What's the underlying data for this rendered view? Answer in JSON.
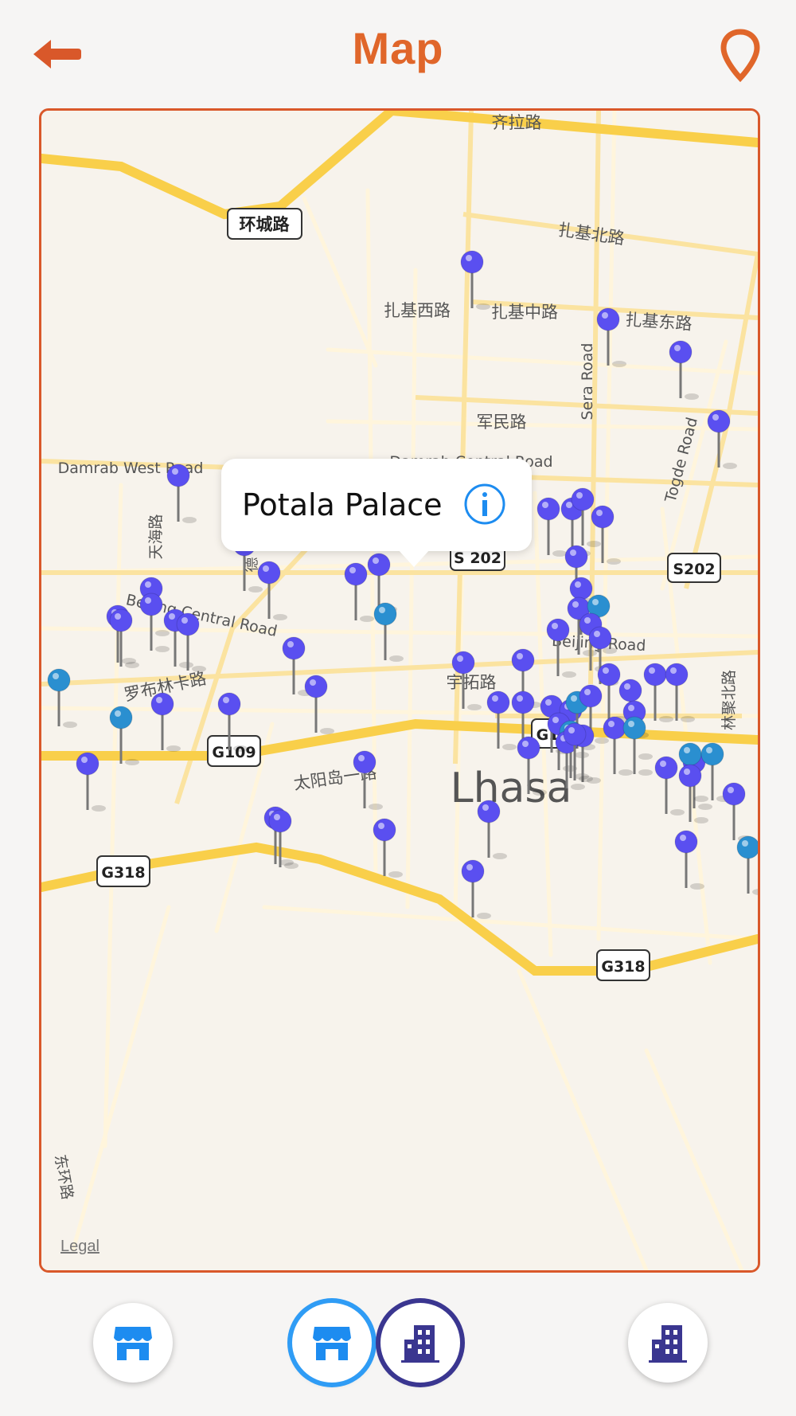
{
  "header": {
    "title": "Map",
    "back_icon": "arrow-left-icon",
    "location_icon": "map-pin-icon",
    "accent_color": "#e0662a"
  },
  "map": {
    "labels": {
      "qila_road": "齐拉路",
      "huancheng_road": "环城路",
      "zhaji_north": "扎基北路",
      "zhaji_west": "扎基西路",
      "zhaji_middle": "扎基中路",
      "zhaji_east": "扎基东路",
      "junmin_road": "军民路",
      "sera_road": "Sera Road",
      "togde_road": "Togde Road",
      "damrab_west": "Damrab West Road",
      "damrab_central": "Damrab Central Road",
      "tianhai_road": "天海路",
      "de_road": "德",
      "beijing_central": "Beijing Central Road",
      "beijing_road": "Beijing Road",
      "luobulinka_road": "罗布林卡路",
      "yutuo_road": "宇拓路",
      "linju_north": "林聚北路",
      "taiyangdao_road": "太阳岛一路",
      "city_name": "Lhasa",
      "dunhuan_road": "东环路"
    },
    "shields": [
      "环城路",
      "S 202",
      "S202",
      "G109",
      "G318",
      "G318",
      "G1"
    ],
    "legal": "Legal",
    "pin_colors": {
      "purple": "#5a4ff0",
      "teal": "#2a8fd0"
    },
    "callout": {
      "title": "Potala Palace",
      "info_icon": "info-circle-icon"
    }
  },
  "bottom_bar": {
    "buttons": [
      {
        "name": "shop-filter-button",
        "icon": "store-icon"
      },
      {
        "name": "shop-active-button",
        "icon": "store-icon"
      },
      {
        "name": "building-active-button",
        "icon": "building-icon"
      },
      {
        "name": "building-filter-button",
        "icon": "building-icon"
      }
    ],
    "ring_colors": {
      "blue": "#2f9cf5",
      "indigo": "#3a3690"
    }
  }
}
